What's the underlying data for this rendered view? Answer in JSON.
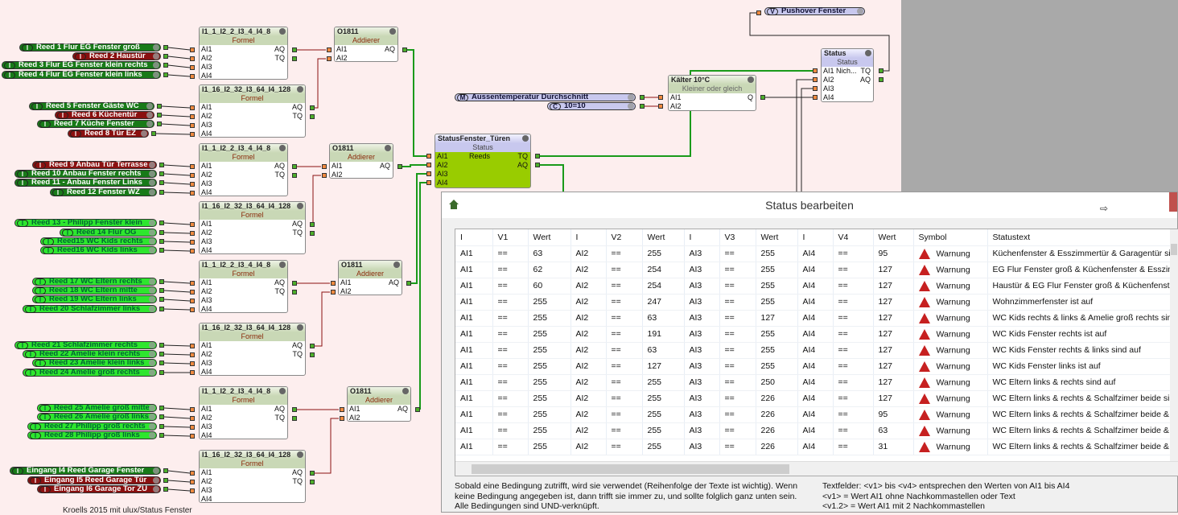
{
  "inputs": [
    {
      "label": "Reed 1 Flur EG Fenster groß",
      "state": "dg"
    },
    {
      "label": "Reed 2 Haustür",
      "state": "dr"
    },
    {
      "label": "Reed 3 Flur EG Fenster klein rechts",
      "state": "dg"
    },
    {
      "label": "Reed 4 Flur EG Fenster klein links",
      "state": "dg"
    },
    {
      "label": "Reed 5 Fenster Gäste WC",
      "state": "dg"
    },
    {
      "label": "Reed 6 Küchentür",
      "state": "dr"
    },
    {
      "label": "Reed 7 Küche Fenster",
      "state": "dg"
    },
    {
      "label": "Reed 8 Tür EZ",
      "state": "dr"
    },
    {
      "label": "Reed 9 Anbau Tür Terrasse",
      "state": "dr"
    },
    {
      "label": "Reed 10 Anbau Fenster rechts",
      "state": "dg"
    },
    {
      "label": "Reed 11 - Anbau Fenster Links",
      "state": "dg"
    },
    {
      "label": "Reed 12 Fenster WZ",
      "state": "dg"
    },
    {
      "label": "Reed 13 - Philipp Fenster klein",
      "state": "bg"
    },
    {
      "label": "Reed 14 Flur OG",
      "state": "bg"
    },
    {
      "label": "Reed15 WC Kids rechts",
      "state": "bg"
    },
    {
      "label": "Reed16 WC Kids links",
      "state": "bg"
    },
    {
      "label": "Reed 17 WC Eltern rechts",
      "state": "bg"
    },
    {
      "label": "Reed 18 WC Eltern mitte",
      "state": "bg"
    },
    {
      "label": "Reed 19 WC Eltern links",
      "state": "bg"
    },
    {
      "label": "Reed 20 Schlafzimmer links",
      "state": "bg"
    },
    {
      "label": "Reed 21 Schlafzimmer rechts",
      "state": "bg"
    },
    {
      "label": "Reed 22 Amelie klein rechts",
      "state": "bg"
    },
    {
      "label": "Reed 23 Amelie klein links",
      "state": "bg"
    },
    {
      "label": "Reed 24 Amelie groß rechts",
      "state": "bg"
    },
    {
      "label": "Reed 25 Amelie groß mitte",
      "state": "bg"
    },
    {
      "label": "Reed 26 Amelie groß links",
      "state": "bg"
    },
    {
      "label": "Reed 27 Philipp groß rechts",
      "state": "bg"
    },
    {
      "label": "Reed 28 Philipp groß links",
      "state": "bg"
    },
    {
      "label": "Eingang I4 Reed Garage Fenster",
      "state": "dg"
    },
    {
      "label": "Eingang I5 Reed  Garage Tür",
      "state": "dr"
    },
    {
      "label": "Eingang I6 Garage Tor ZU",
      "state": "dr"
    }
  ],
  "input_badge": "I",
  "formula_titles": [
    "I1_1_I2_2_I3_4_I4_8",
    "I1_16_I2_32_I3_64_I4_128"
  ],
  "formula_type": "Formel",
  "adder_title": "O1811",
  "adder_type": "Addierer",
  "ports": {
    "ai1": "AI1",
    "ai2": "AI2",
    "ai3": "AI3",
    "ai4": "AI4",
    "aq": "AQ",
    "tq": "TQ",
    "q": "Q",
    "ai1_status": "AI1 Nich..."
  },
  "status_fenster": {
    "title": "StatusFenster_Türen",
    "type": "Status",
    "label": "Reeds"
  },
  "kaelter": {
    "title": "Kälter 10°C",
    "type": "Kleiner oder gleich"
  },
  "status": {
    "title": "Status",
    "type": "Status"
  },
  "aussentemp": {
    "badge": "M",
    "label": "Aussentemperatur Durchschnitt"
  },
  "constant": {
    "badge": "C",
    "label": "10=10"
  },
  "pushover": {
    "badge": "V",
    "label": "Pushover Fenster"
  },
  "footer": "Kroells 2015 mit ulux/Status Fenster",
  "dialog": {
    "title": "Status bearbeiten",
    "columns": [
      "I",
      "V1",
      "Wert",
      "I",
      "V2",
      "Wert",
      "I",
      "V3",
      "Wert",
      "I",
      "V4",
      "Wert",
      "Symbol",
      "Statustext"
    ],
    "rows": [
      [
        "AI1",
        "==",
        "63",
        "AI2",
        "==",
        "255",
        "AI3",
        "==",
        "255",
        "AI4",
        "==",
        "95",
        "Warnung",
        "Küchenfenster & Esszimmertür & Garagentür sind auf"
      ],
      [
        "AI1",
        "==",
        "62",
        "AI2",
        "==",
        "254",
        "AI3",
        "==",
        "255",
        "AI4",
        "==",
        "127",
        "Warnung",
        "EG Flur Fenster groß & Küchenfenster & Esszimmertür"
      ],
      [
        "AI1",
        "==",
        "60",
        "AI2",
        "==",
        "254",
        "AI3",
        "==",
        "255",
        "AI4",
        "==",
        "127",
        "Warnung",
        "Haustür & EG Flur Fenster groß & Küchenfenster"
      ],
      [
        "AI1",
        "==",
        "255",
        "AI2",
        "==",
        "247",
        "AI3",
        "==",
        "255",
        "AI4",
        "==",
        "127",
        "Warnung",
        "Wohnzimmerfenster ist auf"
      ],
      [
        "AI1",
        "==",
        "255",
        "AI2",
        "==",
        "63",
        "AI3",
        "==",
        "127",
        "AI4",
        "==",
        "127",
        "Warnung",
        "WC Kids rechts & links & Amelie groß rechts sind auf"
      ],
      [
        "AI1",
        "==",
        "255",
        "AI2",
        "==",
        "191",
        "AI3",
        "==",
        "255",
        "AI4",
        "==",
        "127",
        "Warnung",
        "WC Kids Fenster rechts ist auf"
      ],
      [
        "AI1",
        "==",
        "255",
        "AI2",
        "==",
        "63",
        "AI3",
        "==",
        "255",
        "AI4",
        "==",
        "127",
        "Warnung",
        "WC Kids Fenster rechts & links sind auf"
      ],
      [
        "AI1",
        "==",
        "255",
        "AI2",
        "==",
        "127",
        "AI3",
        "==",
        "255",
        "AI4",
        "==",
        "127",
        "Warnung",
        "WC Kids Fenster links ist auf"
      ],
      [
        "AI1",
        "==",
        "255",
        "AI2",
        "==",
        "255",
        "AI3",
        "==",
        "250",
        "AI4",
        "==",
        "127",
        "Warnung",
        "WC Eltern links & rechts sind auf"
      ],
      [
        "AI1",
        "==",
        "255",
        "AI2",
        "==",
        "255",
        "AI3",
        "==",
        "226",
        "AI4",
        "==",
        "127",
        "Warnung",
        "WC Eltern links & rechts & Schalfzimer beide sind auf"
      ],
      [
        "AI1",
        "==",
        "255",
        "AI2",
        "==",
        "255",
        "AI3",
        "==",
        "226",
        "AI4",
        "==",
        "95",
        "Warnung",
        "WC Eltern links & rechts & Schalfzimer beide & G"
      ],
      [
        "AI1",
        "==",
        "255",
        "AI2",
        "==",
        "255",
        "AI3",
        "==",
        "226",
        "AI4",
        "==",
        "63",
        "Warnung",
        "WC Eltern links & rechts & Schalfzimer beide & G"
      ],
      [
        "AI1",
        "==",
        "255",
        "AI2",
        "==",
        "255",
        "AI3",
        "==",
        "226",
        "AI4",
        "==",
        "31",
        "Warnung",
        "WC Eltern links & rechts & Schalfzimer beide & G"
      ]
    ],
    "help_left": [
      "Sobald eine Bedingung zutrifft, wird sie verwendet (Reihenfolge der Texte ist wichtig). Wenn",
      "keine Bedingung angegeben ist, dann trifft sie immer zu, und sollte folglich ganz unten sein.",
      "Alle Bedingungen sind UND-verknüpft."
    ],
    "help_right": [
      "Textfelder: <v1> bis <v4> entsprechen den Werten von AI1 bis AI4",
      "<v1> = Wert AI1 ohne Nachkommastellen oder Text",
      "<v1.2> = Wert AI1 mit 2 Nachkommastellen"
    ]
  },
  "colors": {
    "open": "#8a1010",
    "closed_dark": "#187a18",
    "closed_bright": "#2ee62e",
    "status_block": "#99cc00",
    "warning": "#c62020"
  }
}
